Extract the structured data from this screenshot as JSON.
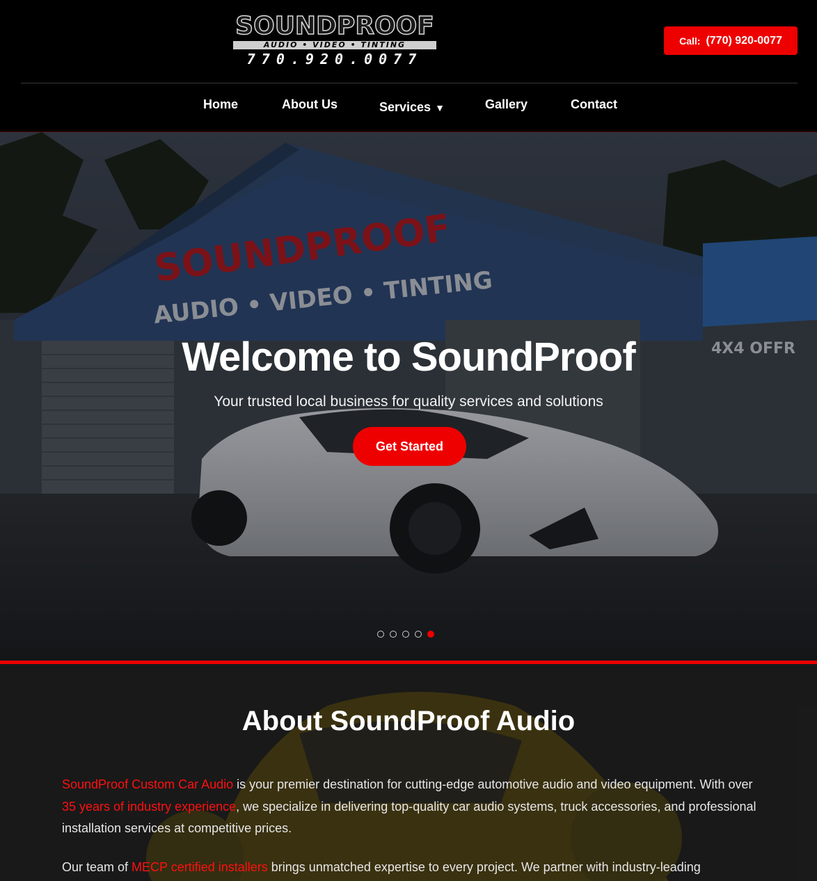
{
  "header": {
    "logo": {
      "wordmark": "SOUNDPROOF",
      "tagline": "AUDIO • VIDEO • TINTING",
      "phone": "770.920.0077"
    },
    "call_button": {
      "label": "Call:",
      "number": "(770) 920-0077"
    },
    "nav": [
      {
        "label": "Home"
      },
      {
        "label": "About Us"
      },
      {
        "label": "Services"
      },
      {
        "label": "Gallery"
      },
      {
        "label": "Contact"
      }
    ]
  },
  "hero": {
    "title": "Welcome to SoundProof",
    "subtitle": "Your trusted local business for quality services and solutions",
    "cta": "Get Started",
    "slides_total": 5,
    "active_slide": 5,
    "background": {
      "sign_main": "SOUNDPROOF",
      "sign_sub": "AUDIO • VIDEO • TINTING",
      "sign_side": "4X4 OFFR"
    }
  },
  "about": {
    "title": "About SoundProof Audio",
    "p1": {
      "highlight1": "SoundProof Custom Car Audio",
      "text1": " is your premier destination for cutting-edge automotive audio and video equipment. With over ",
      "highlight2": "35 years of industry experience",
      "text2": ", we specialize in delivering top-quality car audio systems, truck accessories, and professional installation services at competitive prices."
    },
    "p2": {
      "text1": "Our team of ",
      "highlight1": "MECP certified installers",
      "text2": " brings unmatched expertise to every project. We partner with industry-leading"
    }
  },
  "colors": {
    "accent": "#ee0000",
    "background": "#000000",
    "text": "#ffffff"
  }
}
